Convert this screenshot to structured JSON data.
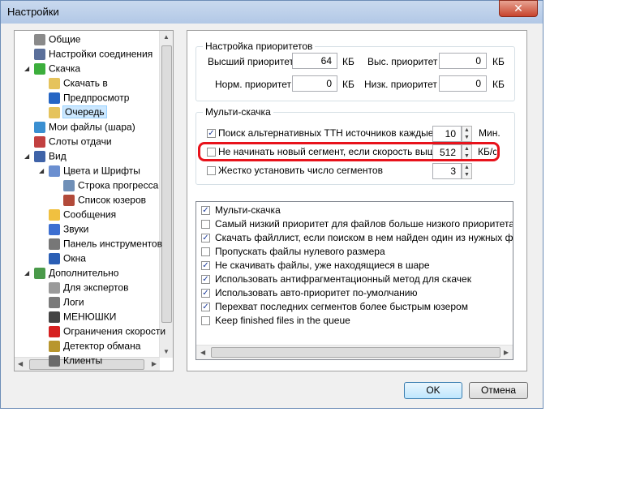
{
  "window": {
    "title": "Настройки",
    "close_glyph": "✕"
  },
  "tree": {
    "items": [
      {
        "label": "Общие",
        "icon": "gear-icon",
        "color": "#8a8a8a"
      },
      {
        "label": "Настройки соединения",
        "icon": "network-icon",
        "color": "#5a6f9a"
      },
      {
        "label": "Скачка",
        "icon": "download-arrow-icon",
        "color": "#3cae3c"
      },
      {
        "label": "Скачать в",
        "icon": "folder-icon",
        "color": "#e5c35c"
      },
      {
        "label": "Предпросмотр",
        "icon": "play-icon",
        "color": "#2565c4"
      },
      {
        "label": "Очередь",
        "icon": "folder-icon",
        "color": "#e5c35c"
      },
      {
        "label": "Мои файлы (шара)",
        "icon": "share-icon",
        "color": "#3a8fd1"
      },
      {
        "label": "Слоты отдачи",
        "icon": "slots-icon",
        "color": "#c24040"
      },
      {
        "label": "Вид",
        "icon": "monitor-icon",
        "color": "#3f63a8"
      },
      {
        "label": "Цвета и Шрифты",
        "icon": "colors-icon",
        "color": "#6b8fd0"
      },
      {
        "label": "Строка прогресса",
        "icon": "progress-icon",
        "color": "#6f8fb7"
      },
      {
        "label": "Список юзеров",
        "icon": "users-icon",
        "color": "#b24a3a"
      },
      {
        "label": "Сообщения",
        "icon": "message-icon",
        "color": "#f0c040"
      },
      {
        "label": "Звуки",
        "icon": "music-icon",
        "color": "#3d6fd1"
      },
      {
        "label": "Панель инструментов",
        "icon": "toolbar-icon",
        "color": "#777777"
      },
      {
        "label": "Окна",
        "icon": "window-icon",
        "color": "#2b5fb5"
      },
      {
        "label": "Дополнительно",
        "icon": "tools-icon",
        "color": "#4a9a4a"
      },
      {
        "label": "Для экспертов",
        "icon": "gear-icon",
        "color": "#9a9a9a"
      },
      {
        "label": "Логи",
        "icon": "log-icon",
        "color": "#7a7a7a"
      },
      {
        "label": "МЕНЮШКИ",
        "icon": "menu-icon",
        "color": "#444444"
      },
      {
        "label": "Ограничения скорости",
        "icon": "speed-limit-icon",
        "color": "#d62020"
      },
      {
        "label": "Детектор обмана",
        "icon": "lock-icon",
        "color": "#b8962e"
      },
      {
        "label": "Клиенты",
        "icon": "clients-icon",
        "color": "#6a6a6a"
      }
    ]
  },
  "priorities": {
    "title": "Настройка приоритетов",
    "highest_label": "Высший приоритет",
    "highest_value": "64",
    "high_label": "Выс. приоритет",
    "high_value": "0",
    "normal_label": "Норм. приоритет",
    "normal_value": "0",
    "low_label": "Низк. приоритет",
    "low_value": "0",
    "unit": "КБ"
  },
  "multi": {
    "title": "Мульти-скачка",
    "search_tth_label": "Поиск альтернативных TTH источников каждые",
    "search_tth_value": "10",
    "search_tth_unit": "Мин.",
    "search_tth_checked": true,
    "no_new_segment_label": "Не начинать новый сегмент, если скорость выше",
    "no_new_segment_value": "512",
    "no_new_segment_unit": "КБ/с",
    "no_new_segment_checked": false,
    "fixed_segments_label": "Жестко установить число сегментов",
    "fixed_segments_value": "3",
    "fixed_segments_checked": false
  },
  "options": [
    {
      "label": "Мульти-скачка",
      "checked": true
    },
    {
      "label": "Самый низкий приоритет для файлов больше низкого приоритета",
      "checked": false
    },
    {
      "label": "Скачать файллист, если поиском в нем найден один из нужных файлов",
      "checked": true
    },
    {
      "label": "Пропускать файлы нулевого размера",
      "checked": false
    },
    {
      "label": "Не скачивать файлы, уже находящиеся в шаре",
      "checked": true
    },
    {
      "label": "Использовать антифрагментационный метод для скачек",
      "checked": true
    },
    {
      "label": "Использовать авто-приоритет по-умолчанию",
      "checked": true
    },
    {
      "label": "Перехват последних сегментов более быстрым юзером",
      "checked": true
    },
    {
      "label": "Keep finished files in the queue",
      "checked": false
    }
  ],
  "buttons": {
    "ok": "OK",
    "cancel": "Отмена"
  }
}
